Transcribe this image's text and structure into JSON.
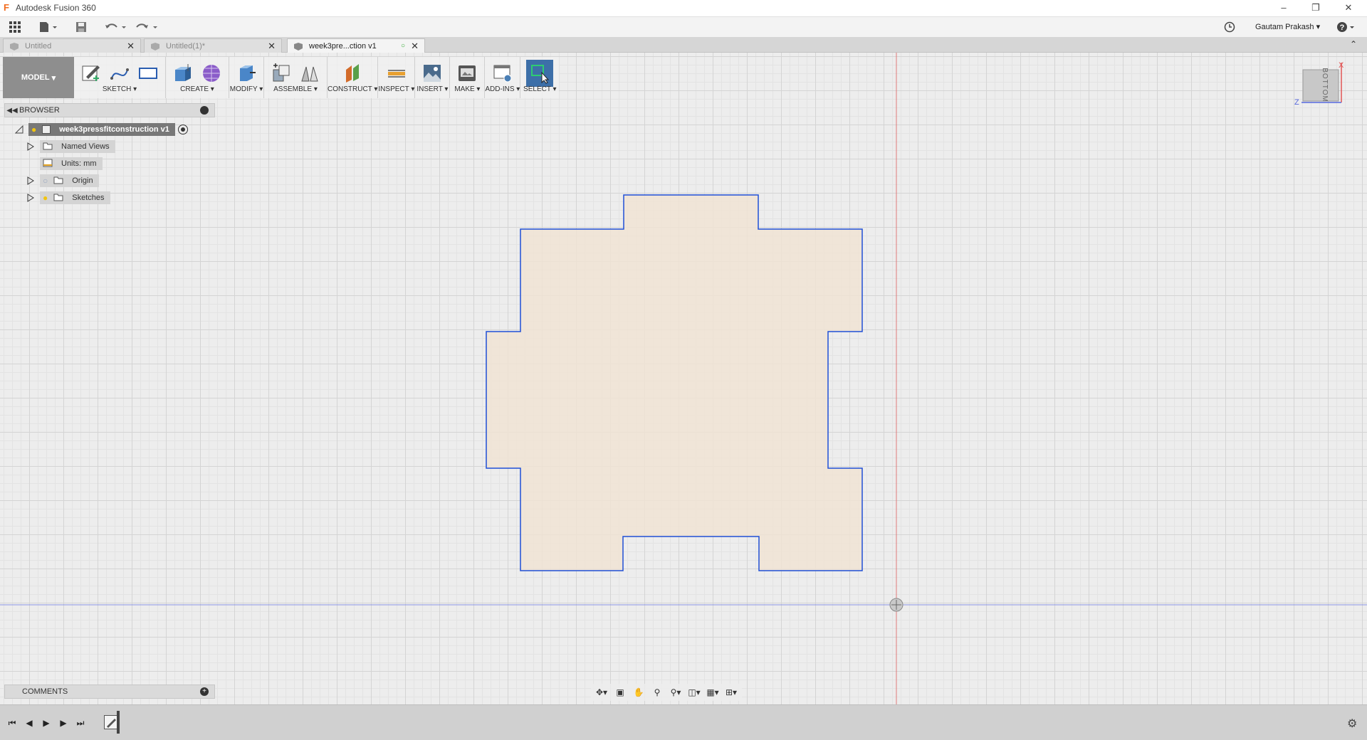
{
  "app": {
    "title": "Autodesk Fusion 360",
    "user": "Gautam Prakash"
  },
  "tabs": [
    {
      "label": "Untitled",
      "active": false
    },
    {
      "label": "Untitled(1)*",
      "active": false
    },
    {
      "label": "week3pre...ction v1",
      "active": true
    }
  ],
  "toolbar": {
    "model_label": "MODEL",
    "groups": [
      {
        "label": "SKETCH"
      },
      {
        "label": "CREATE"
      },
      {
        "label": "MODIFY"
      },
      {
        "label": "ASSEMBLE"
      },
      {
        "label": "CONSTRUCT"
      },
      {
        "label": "INSPECT"
      },
      {
        "label": "INSERT"
      },
      {
        "label": "MAKE"
      },
      {
        "label": "ADD-INS"
      },
      {
        "label": "SELECT"
      }
    ]
  },
  "browser": {
    "title": "BROWSER",
    "root": "week3pressfitconstruction v1",
    "items": [
      {
        "label": "Named Views"
      },
      {
        "label": "Units: mm"
      },
      {
        "label": "Origin"
      },
      {
        "label": "Sketches"
      }
    ]
  },
  "comments": {
    "title": "COMMENTS"
  },
  "viewcube": {
    "face": "BOTTOM",
    "axis_x": "X",
    "axis_z": "Z"
  },
  "colors": {
    "sketch_line": "#1f4fd6",
    "sketch_fill": "#f0e3d3",
    "axis_red": "#e06060",
    "axis_blue": "#6f7fe0",
    "select_active": "#3d6fa8"
  }
}
